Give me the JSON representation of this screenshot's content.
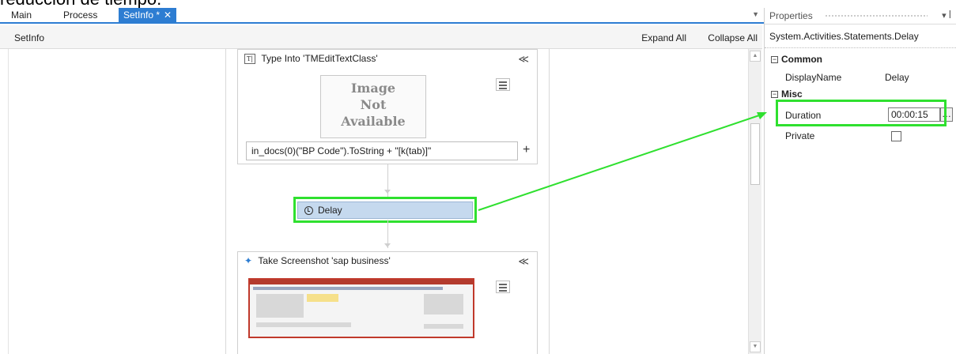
{
  "caption": "reducción de tiempo.",
  "tabs": [
    {
      "label": "Main"
    },
    {
      "label": "Process"
    },
    {
      "label": "SetInfo *",
      "active": true
    }
  ],
  "designer": {
    "breadcrumb": "SetInfo",
    "expand_all": "Expand All",
    "collapse_all": "Collapse All"
  },
  "type_into": {
    "title": "Type Into 'TMEditTextClass'",
    "image_placeholder": [
      "Image",
      "Not",
      "Available"
    ],
    "expression": "in_docs(0)(\"BP Code\").ToString + \"[k(tab)]\""
  },
  "delay": {
    "label": "Delay"
  },
  "screenshot": {
    "title": "Take Screenshot 'sap business'"
  },
  "properties": {
    "title": "Properties",
    "type_name": "System.Activities.Statements.Delay",
    "categories": {
      "common": "Common",
      "misc": "Misc"
    },
    "display_name": {
      "key": "DisplayName",
      "value": "Delay"
    },
    "duration": {
      "key": "Duration",
      "value": "00:00:15"
    },
    "private": {
      "key": "Private",
      "checked": false
    }
  },
  "colors": {
    "accent": "#2d7dd2",
    "highlight": "#2fe02f",
    "activity_selected": "#c5d9ee"
  },
  "icons": [
    "close-icon",
    "chevron-down-icon",
    "pin-icon",
    "type-into-icon",
    "collapse-icon",
    "menu-icon",
    "plus-icon",
    "clock-icon",
    "screenshot-icon",
    "ellipsis-icon"
  ]
}
